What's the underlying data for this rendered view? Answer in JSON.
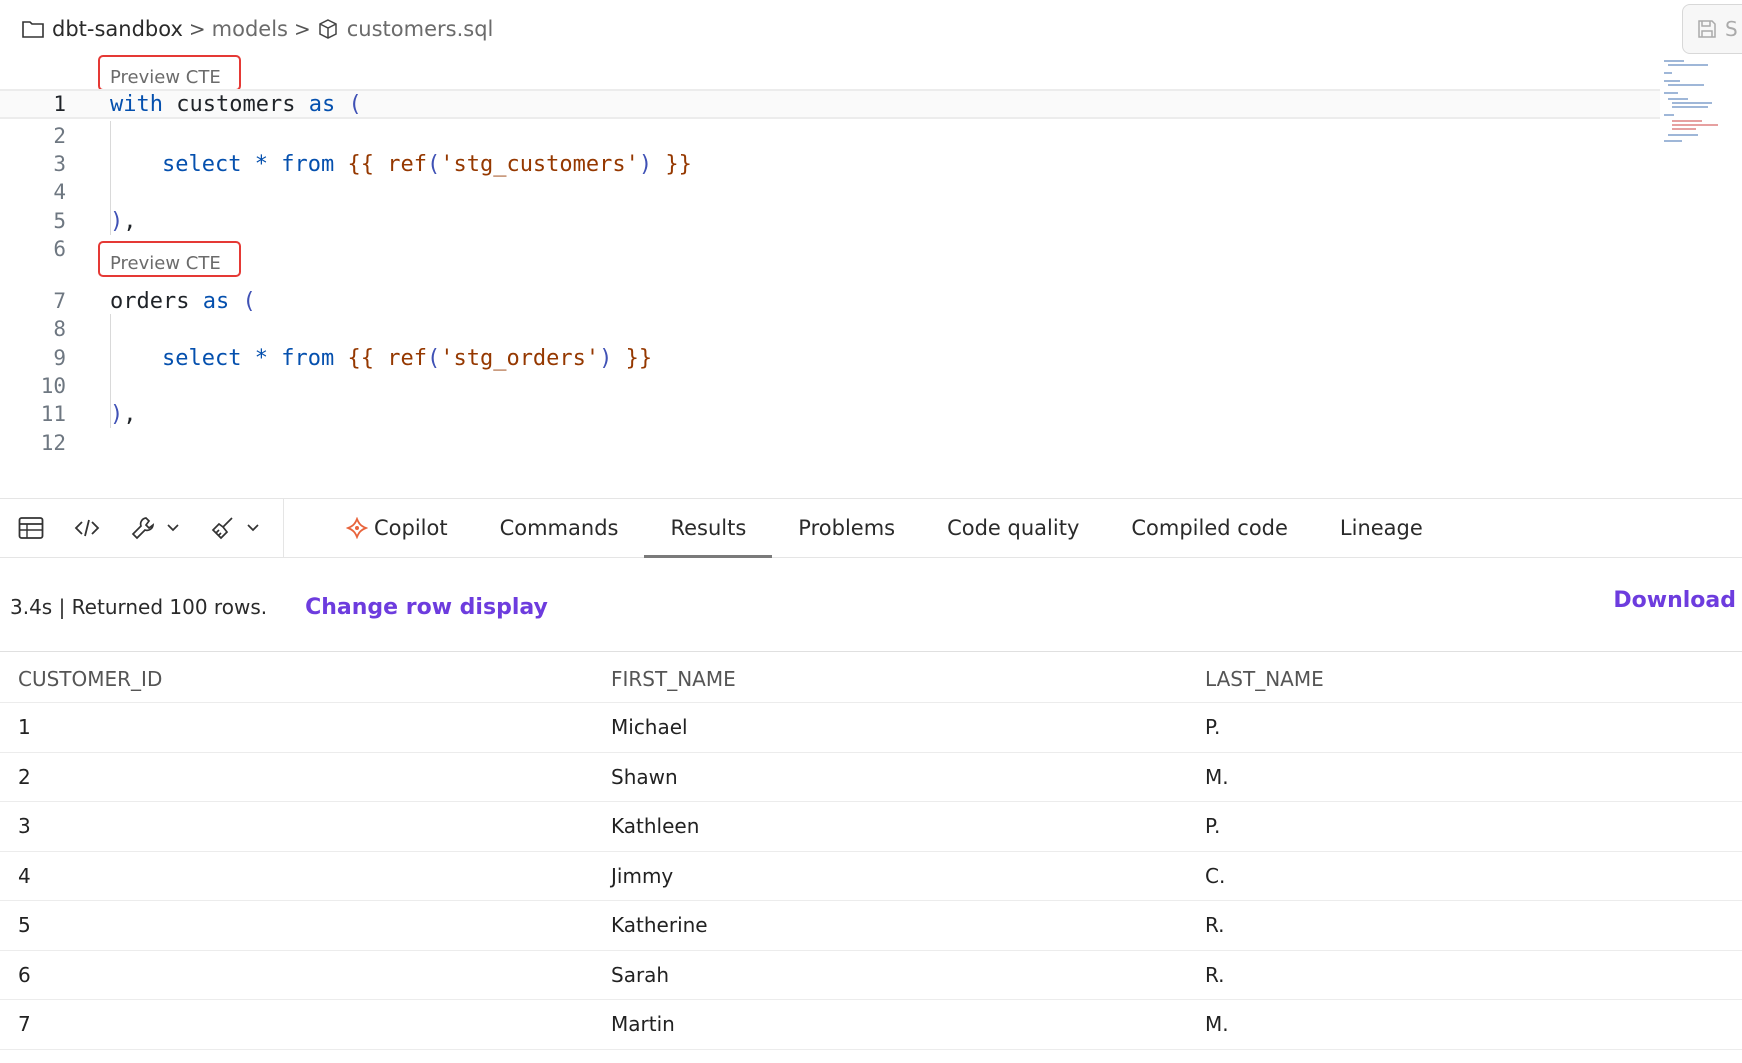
{
  "breadcrumb": {
    "project": "dbt-sandbox",
    "folder": "models",
    "file": "customers.sql",
    "separator": ">"
  },
  "save_button": {
    "label": "S"
  },
  "code_lens_label": "Preview CTE",
  "editor": {
    "lines": [
      {
        "n": "1"
      },
      {
        "n": "2"
      },
      {
        "n": "3"
      },
      {
        "n": "4"
      },
      {
        "n": "5"
      },
      {
        "n": "6"
      },
      {
        "n": "7"
      },
      {
        "n": "8"
      },
      {
        "n": "9"
      },
      {
        "n": "10"
      },
      {
        "n": "11"
      },
      {
        "n": "12"
      }
    ],
    "tokens": {
      "with": "with",
      "customers": "customers",
      "as": "as",
      "open_paren": "(",
      "select": "select",
      "star": "*",
      "from": "from",
      "open_braces": "{{",
      "ref": "ref",
      "ref_open": "(",
      "stg_customers": "'stg_customers'",
      "ref_close": ")",
      "close_braces": "}}",
      "close_paren": ")",
      "comma": ",",
      "orders": "orders",
      "stg_orders": "'stg_orders'"
    }
  },
  "toolbar": {
    "tabs": [
      {
        "label": "Copilot"
      },
      {
        "label": "Commands"
      },
      {
        "label": "Results"
      },
      {
        "label": "Problems"
      },
      {
        "label": "Code quality"
      },
      {
        "label": "Compiled code"
      },
      {
        "label": "Lineage"
      }
    ],
    "active_tab": "Results"
  },
  "results": {
    "summary": "3.4s | Returned 100 rows.",
    "change_row_display": "Change row display",
    "download": "Download",
    "columns": [
      "CUSTOMER_ID",
      "FIRST_NAME",
      "LAST_NAME"
    ],
    "rows": [
      [
        "1",
        "Michael",
        "P."
      ],
      [
        "2",
        "Shawn",
        "M."
      ],
      [
        "3",
        "Kathleen",
        "P."
      ],
      [
        "4",
        "Jimmy",
        "C."
      ],
      [
        "5",
        "Katherine",
        "R."
      ],
      [
        "6",
        "Sarah",
        "R."
      ],
      [
        "7",
        "Martin",
        "M."
      ]
    ]
  },
  "colors": {
    "keyword": "#0550ae",
    "string": "#953800",
    "link": "#6d3cde",
    "lens_border": "#e53935"
  }
}
